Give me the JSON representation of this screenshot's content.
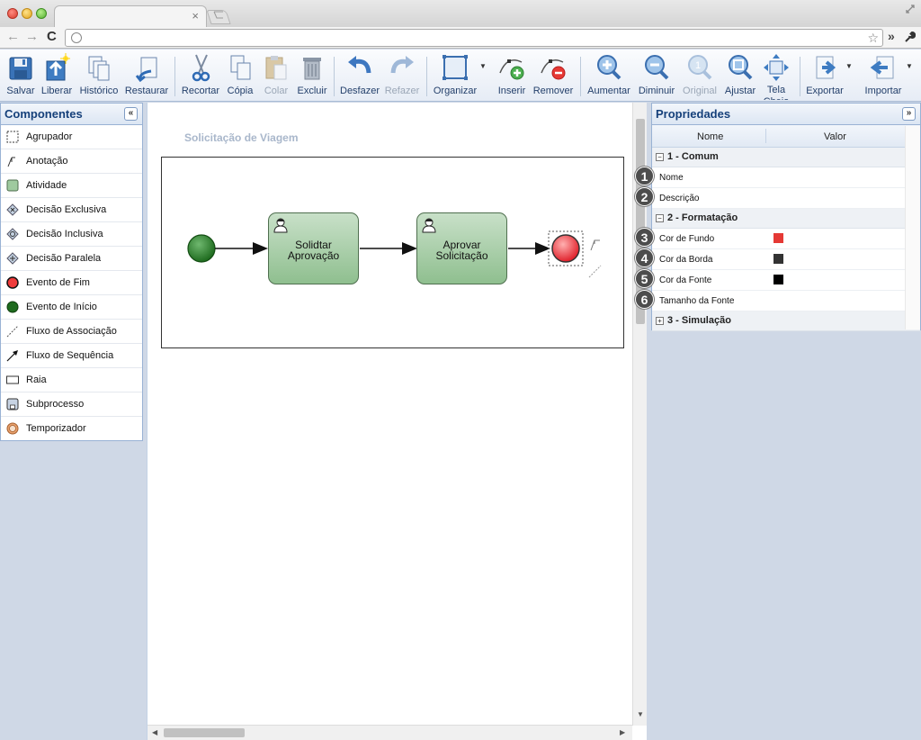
{
  "browser": {
    "tab_close": "×",
    "nav_back": "←",
    "nav_forward": "→",
    "nav_reload": "C",
    "star": "☆",
    "more": "»"
  },
  "toolbar": {
    "items": [
      {
        "label": "Salvar",
        "icon": "save-icon"
      },
      {
        "label": "Liberar",
        "icon": "publish-icon"
      },
      {
        "label": "Histórico",
        "icon": "history-icon"
      },
      {
        "label": "Restaurar",
        "icon": "restore-icon"
      },
      {
        "label": "Recortar",
        "icon": "scissors-icon"
      },
      {
        "label": "Cópia",
        "icon": "copy-icon"
      },
      {
        "label": "Colar",
        "icon": "paste-icon"
      },
      {
        "label": "Excluir",
        "icon": "trash-icon"
      },
      {
        "label": "Desfazer",
        "icon": "undo-icon"
      },
      {
        "label": "Refazer",
        "icon": "redo-icon"
      },
      {
        "label": "Organizar",
        "icon": "organize-icon"
      },
      {
        "label": "Inserir",
        "icon": "insert-point-icon"
      },
      {
        "label": "Remover",
        "icon": "remove-point-icon"
      },
      {
        "label": "Aumentar",
        "icon": "zoom-in-icon"
      },
      {
        "label": "Diminuir",
        "icon": "zoom-out-icon"
      },
      {
        "label": "Original",
        "icon": "zoom-original-icon"
      },
      {
        "label": "Ajustar",
        "icon": "zoom-fit-icon"
      },
      {
        "label": "Tela Cheia",
        "icon": "fullscreen-icon"
      },
      {
        "label": "Exportar",
        "icon": "export-icon"
      },
      {
        "label": "Importar",
        "icon": "import-icon"
      }
    ]
  },
  "components": {
    "title": "Componentes",
    "collapse": "«",
    "items": [
      {
        "label": "Agrupador",
        "icon": "group-icon"
      },
      {
        "label": "Anotação",
        "icon": "annotation-icon"
      },
      {
        "label": "Atividade",
        "icon": "activity-icon"
      },
      {
        "label": "Decisão Exclusiva",
        "icon": "exclusive-gateway-icon"
      },
      {
        "label": "Decisão Inclusiva",
        "icon": "inclusive-gateway-icon"
      },
      {
        "label": "Decisão Paralela",
        "icon": "parallel-gateway-icon"
      },
      {
        "label": "Evento de Fim",
        "icon": "end-event-icon"
      },
      {
        "label": "Evento de Início",
        "icon": "start-event-icon"
      },
      {
        "label": "Fluxo de Associação",
        "icon": "association-flow-icon"
      },
      {
        "label": "Fluxo de Sequência",
        "icon": "sequence-flow-icon"
      },
      {
        "label": "Raia",
        "icon": "lane-icon"
      },
      {
        "label": "Subprocesso",
        "icon": "subprocess-icon"
      },
      {
        "label": "Temporizador",
        "icon": "timer-icon"
      }
    ]
  },
  "diagram": {
    "title": "Solicitação de Viagem",
    "tasks": [
      {
        "label": "Solidtar\nAprovação"
      },
      {
        "label": "Aprovar\nSolicitação"
      }
    ]
  },
  "properties": {
    "title": "Propriedades",
    "collapse": "»",
    "col_name": "Nome",
    "col_value": "Valor",
    "groups": [
      {
        "sign": "−",
        "label": "1 - Comum"
      },
      {
        "sign": "−",
        "label": "2 - Formatação"
      },
      {
        "sign": "+",
        "label": "3 - Simulação"
      }
    ],
    "rows": [
      {
        "callout": "1",
        "name": "Nome"
      },
      {
        "callout": "2",
        "name": "Descrição"
      },
      {
        "callout": "3",
        "name": "Cor de Fundo",
        "swatch": "#e53935"
      },
      {
        "callout": "4",
        "name": "Cor da Borda",
        "swatch": "#333333"
      },
      {
        "callout": "5",
        "name": "Cor da Fonte",
        "swatch": "#000000"
      },
      {
        "callout": "6",
        "name": "Tamanho da Fonte"
      }
    ]
  },
  "colors": {
    "accent": "#15407a",
    "task_fill": "#a8cfa8",
    "start_event": "#2e7d32",
    "end_event": "#ef5350"
  }
}
